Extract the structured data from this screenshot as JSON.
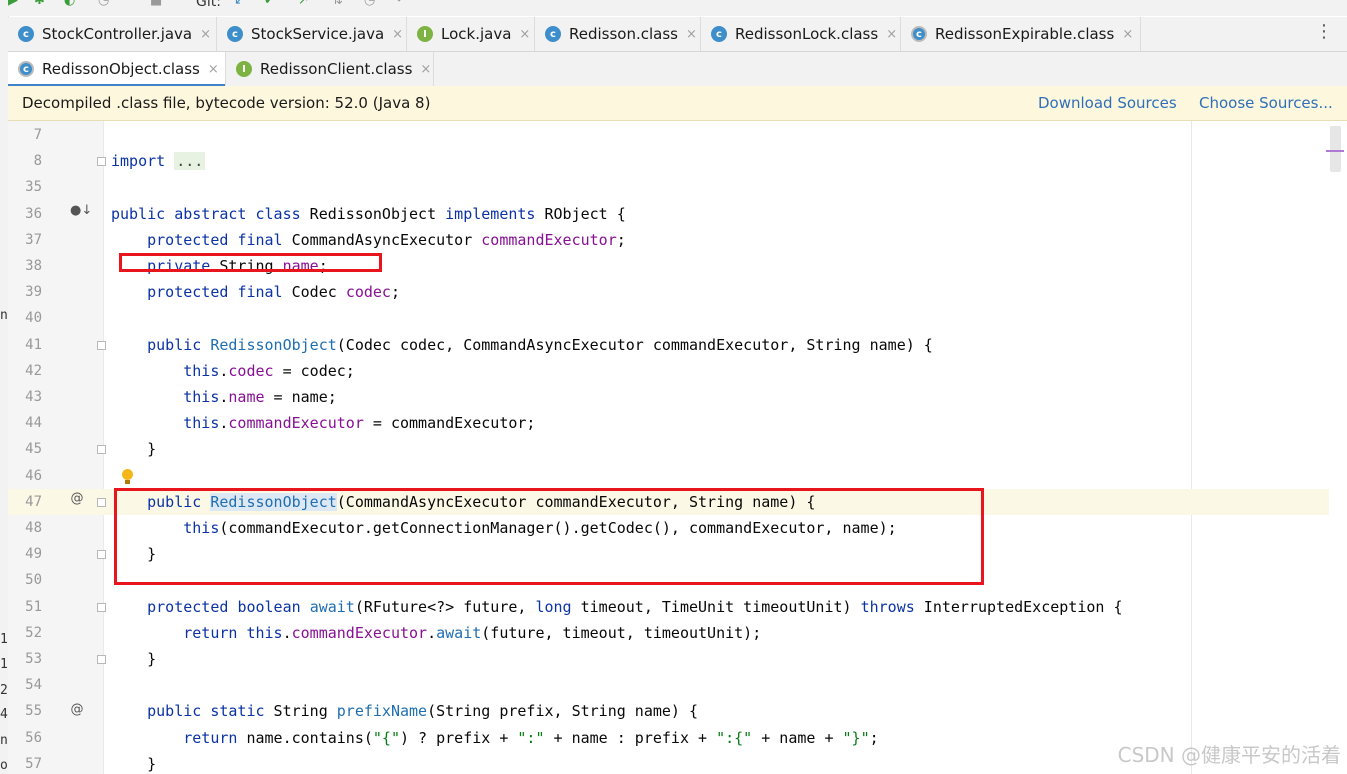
{
  "toolbar": {
    "git_label": "Git:"
  },
  "tabs_row1": [
    {
      "label": "StockController.java",
      "icon": "class-icon",
      "close": "×"
    },
    {
      "label": "StockService.java",
      "icon": "class-icon",
      "close": "×"
    },
    {
      "label": "Lock.java",
      "icon": "interface-icon",
      "close": "×"
    },
    {
      "label": "Redisson.class",
      "icon": "class-file-icon",
      "close": "×"
    },
    {
      "label": "RedissonLock.class",
      "icon": "class-file-icon",
      "close": "×"
    },
    {
      "label": "RedissonExpirable.class",
      "icon": "class-file-icon",
      "close": "×"
    }
  ],
  "tabs_row2": [
    {
      "label": "RedissonObject.class",
      "icon": "class-file-icon",
      "close": "×",
      "active": true
    },
    {
      "label": "RedissonClient.class",
      "icon": "interface-icon",
      "close": "×"
    }
  ],
  "banner": {
    "message": "Decompiled .class file, bytecode version: 52.0 (Java 8)",
    "download_sources": "Download Sources",
    "choose_sources": "Choose Sources..."
  },
  "editor": {
    "lines": [
      {
        "num": "7",
        "text": ""
      },
      {
        "num": "8",
        "text": "import ..."
      },
      {
        "num": "35",
        "text": ""
      },
      {
        "num": "36",
        "text": "public abstract class RedissonObject implements RObject {"
      },
      {
        "num": "37",
        "text": "    protected final CommandAsyncExecutor commandExecutor;"
      },
      {
        "num": "38",
        "text": "    private String name;"
      },
      {
        "num": "39",
        "text": "    protected final Codec codec;"
      },
      {
        "num": "40",
        "text": ""
      },
      {
        "num": "41",
        "text": "    public RedissonObject(Codec codec, CommandAsyncExecutor commandExecutor, String name) {"
      },
      {
        "num": "42",
        "text": "        this.codec = codec;"
      },
      {
        "num": "43",
        "text": "        this.name = name;"
      },
      {
        "num": "44",
        "text": "        this.commandExecutor = commandExecutor;"
      },
      {
        "num": "45",
        "text": "    }"
      },
      {
        "num": "46",
        "text": ""
      },
      {
        "num": "47",
        "text": "    public RedissonObject(CommandAsyncExecutor commandExecutor, String name) {"
      },
      {
        "num": "48",
        "text": "        this(commandExecutor.getConnectionManager().getCodec(), commandExecutor, name);"
      },
      {
        "num": "49",
        "text": "    }"
      },
      {
        "num": "50",
        "text": ""
      },
      {
        "num": "51",
        "text": "    protected boolean await(RFuture<?> future, long timeout, TimeUnit timeoutUnit) throws InterruptedException {"
      },
      {
        "num": "52",
        "text": "        return this.commandExecutor.await(future, timeout, timeoutUnit);"
      },
      {
        "num": "53",
        "text": "    }"
      },
      {
        "num": "54",
        "text": ""
      },
      {
        "num": "55",
        "text": "    public static String prefixName(String prefix, String name) {"
      },
      {
        "num": "56",
        "text": "        return name.contains(\"{\") ? prefix + \":\" + name : prefix + \":{\" + name + \"}\";"
      },
      {
        "num": "57",
        "text": "    }"
      }
    ]
  },
  "gutter_marks": {
    "implements_mark": "●↓",
    "override_mark_47": "@",
    "override_mark_55": "@"
  },
  "left_fragments": [
    "n",
    "1",
    "1",
    "2",
    "4.",
    "n",
    "o"
  ],
  "watermark": "CSDN @健康平安的活着",
  "colors": {
    "keyword": "#0b33a6",
    "field": "#871094",
    "method": "#1f6eb0",
    "string": "#067d17",
    "highlight_box": "#e8151c",
    "active_tab_underline": "#4083c9",
    "banner_bg": "#fdf8dd"
  }
}
